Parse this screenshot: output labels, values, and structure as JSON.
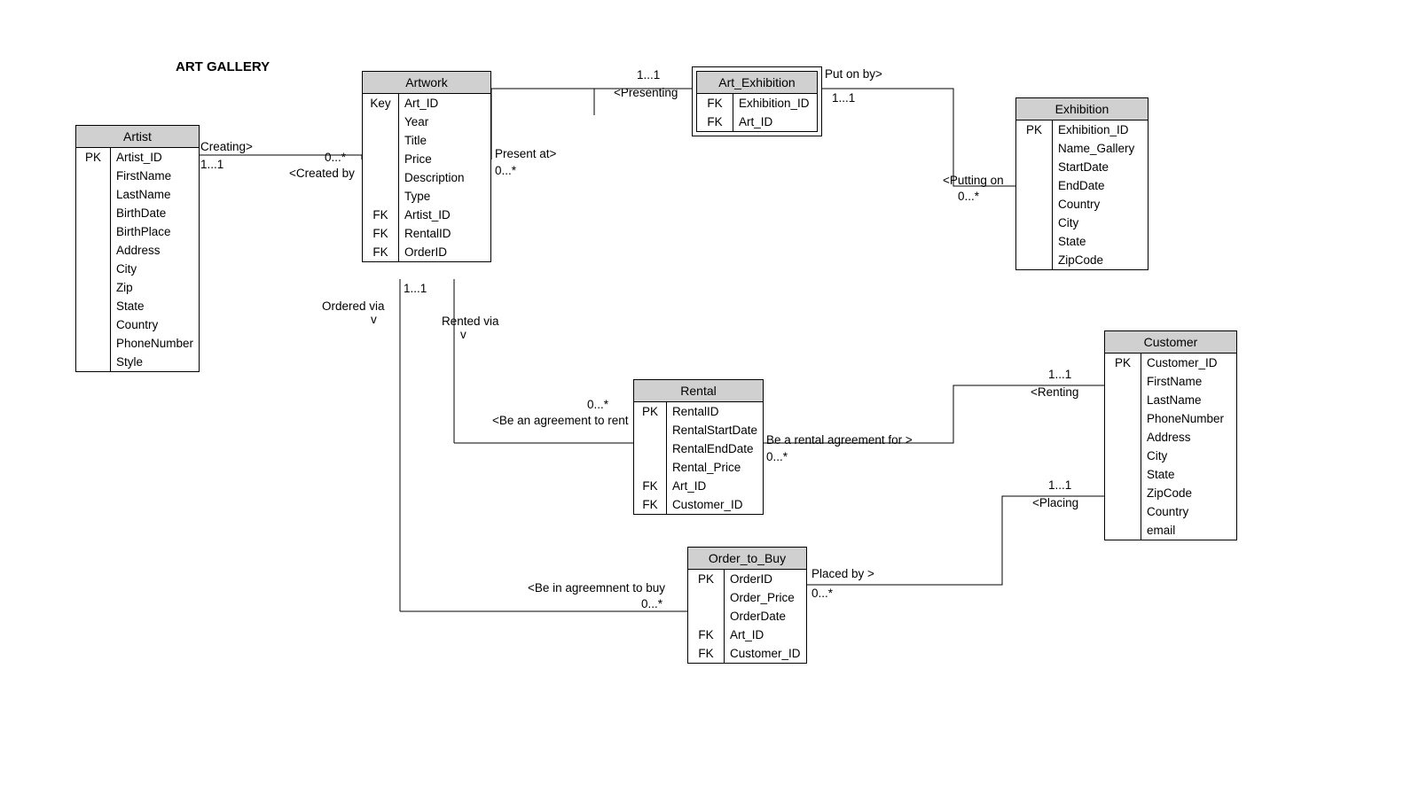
{
  "title": "ART GALLERY",
  "entities": {
    "artist": {
      "name": "Artist",
      "rows": [
        {
          "key": "PK",
          "attr": "Artist_ID"
        },
        {
          "key": "",
          "attr": "FirstName"
        },
        {
          "key": "",
          "attr": "LastName"
        },
        {
          "key": "",
          "attr": "BirthDate"
        },
        {
          "key": "",
          "attr": "BirthPlace"
        },
        {
          "key": "",
          "attr": "Address"
        },
        {
          "key": "",
          "attr": "City"
        },
        {
          "key": "",
          "attr": "Zip"
        },
        {
          "key": "",
          "attr": "State"
        },
        {
          "key": "",
          "attr": "Country"
        },
        {
          "key": "",
          "attr": "PhoneNumber"
        },
        {
          "key": "",
          "attr": "Style"
        }
      ]
    },
    "artwork": {
      "name": "Artwork",
      "rows": [
        {
          "key": "Key",
          "attr": "Art_ID"
        },
        {
          "key": "",
          "attr": "Year"
        },
        {
          "key": "",
          "attr": "Title"
        },
        {
          "key": "",
          "attr": "Price"
        },
        {
          "key": "",
          "attr": "Description"
        },
        {
          "key": "",
          "attr": "Type"
        },
        {
          "key": "FK",
          "attr": "Artist_ID"
        },
        {
          "key": "FK",
          "attr": "RentalID"
        },
        {
          "key": "FK",
          "attr": "OrderID"
        }
      ]
    },
    "art_exhibition": {
      "name": "Art_Exhibition",
      "rows": [
        {
          "key": "FK",
          "attr": "Exhibition_ID"
        },
        {
          "key": "FK",
          "attr": "Art_ID"
        }
      ]
    },
    "exhibition": {
      "name": "Exhibition",
      "rows": [
        {
          "key": "PK",
          "attr": "Exhibition_ID"
        },
        {
          "key": "",
          "attr": "Name_Gallery"
        },
        {
          "key": "",
          "attr": "StartDate"
        },
        {
          "key": "",
          "attr": "EndDate"
        },
        {
          "key": "",
          "attr": "Country"
        },
        {
          "key": "",
          "attr": "City"
        },
        {
          "key": "",
          "attr": "State"
        },
        {
          "key": "",
          "attr": "ZipCode"
        }
      ]
    },
    "rental": {
      "name": "Rental",
      "rows": [
        {
          "key": "PK",
          "attr": "RentalID"
        },
        {
          "key": "",
          "attr": "RentalStartDate"
        },
        {
          "key": "",
          "attr": "RentalEndDate"
        },
        {
          "key": "",
          "attr": "Rental_Price"
        },
        {
          "key": "FK",
          "attr": "Art_ID"
        },
        {
          "key": "FK",
          "attr": "Customer_ID"
        }
      ]
    },
    "order": {
      "name": "Order_to_Buy",
      "rows": [
        {
          "key": "PK",
          "attr": "OrderID"
        },
        {
          "key": "",
          "attr": "Order_Price"
        },
        {
          "key": "",
          "attr": "OrderDate"
        },
        {
          "key": "FK",
          "attr": "Art_ID"
        },
        {
          "key": "FK",
          "attr": "Customer_ID"
        }
      ]
    },
    "customer": {
      "name": "Customer",
      "rows": [
        {
          "key": "PK",
          "attr": "Customer_ID"
        },
        {
          "key": "",
          "attr": "FirstName"
        },
        {
          "key": "",
          "attr": "LastName"
        },
        {
          "key": "",
          "attr": "PhoneNumber"
        },
        {
          "key": "",
          "attr": "Address"
        },
        {
          "key": "",
          "attr": "City"
        },
        {
          "key": "",
          "attr": "State"
        },
        {
          "key": "",
          "attr": "ZipCode"
        },
        {
          "key": "",
          "attr": "Country"
        },
        {
          "key": "",
          "attr": "email"
        }
      ]
    }
  },
  "labels": {
    "creating": "Creating>",
    "one_one_a": "1...1",
    "zero_star_a": "0...*",
    "created_by": "<Created by",
    "present_at": "Present at>",
    "zero_star_b": "0...*",
    "one_one_b": "1...1",
    "presenting": "<Presenting",
    "put_on_by": "Put on by>",
    "one_one_c": "1...1",
    "putting_on": "<Putting on",
    "zero_star_c": "0...*",
    "ordered_via": "Ordered via",
    "v1": "v",
    "rented_via": "Rented via",
    "v2": "v",
    "one_one_d": "1...1",
    "zero_star_d": "0...*",
    "be_rent": "<Be an agreement to rent",
    "be_rental_for": "Be a rental agreement for >",
    "zero_star_e": "0...*",
    "one_one_e": "1...1",
    "renting": "<Renting",
    "one_one_f": "1...1",
    "placing": "<Placing",
    "placed_by": "Placed by >",
    "zero_star_f": "0...*",
    "be_buy": "<Be in agreemnent to buy",
    "zero_star_g": "0...*"
  }
}
